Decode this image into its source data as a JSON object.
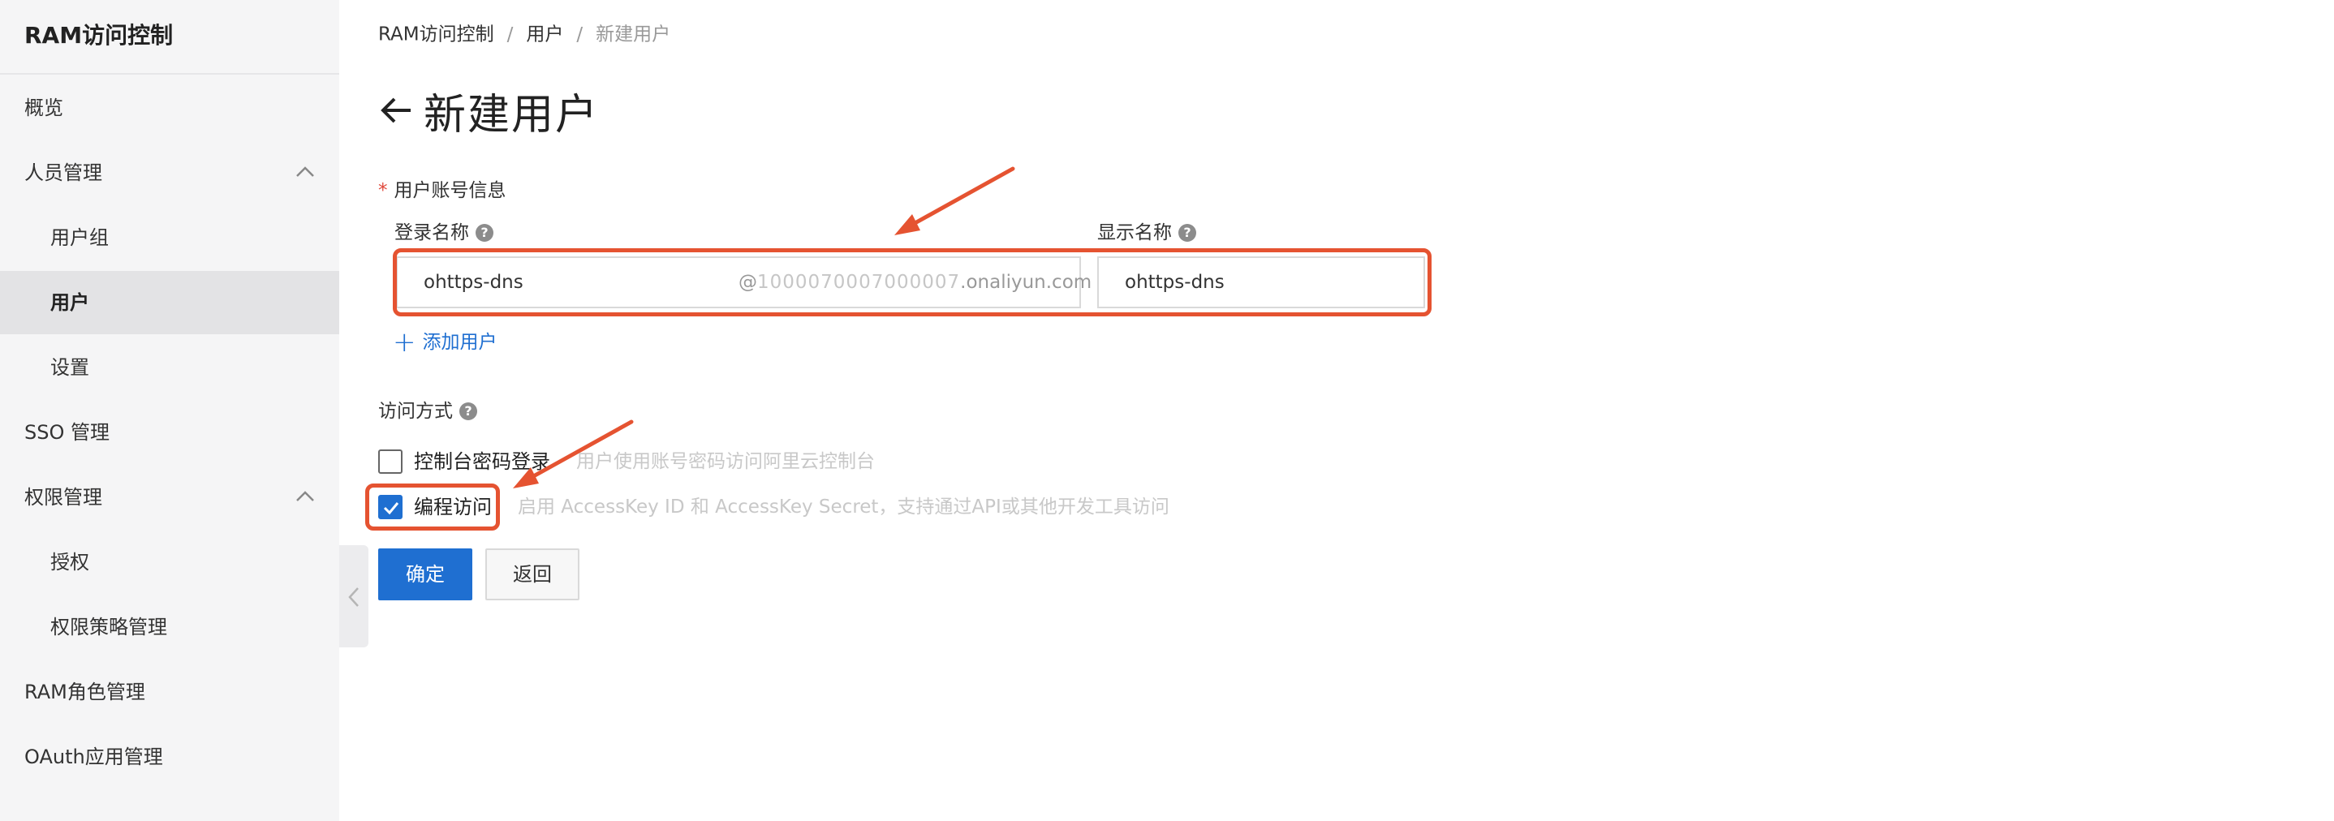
{
  "sidebar": {
    "title": "RAM访问控制",
    "items": [
      {
        "label": "概览"
      },
      {
        "label": "人员管理"
      },
      {
        "label": "用户组"
      },
      {
        "label": "用户"
      },
      {
        "label": "设置"
      },
      {
        "label": "SSO 管理"
      },
      {
        "label": "权限管理"
      },
      {
        "label": "授权"
      },
      {
        "label": "权限策略管理"
      },
      {
        "label": "RAM角色管理"
      },
      {
        "label": "OAuth应用管理"
      }
    ]
  },
  "breadcrumb": {
    "items": [
      "RAM访问控制",
      "用户",
      "新建用户"
    ],
    "separator": "/"
  },
  "page": {
    "title": "新建用户"
  },
  "form": {
    "account_section_label": "用户账号信息",
    "required_mark": "*",
    "login_name_label": "登录名称",
    "display_name_label": "显示名称",
    "help_glyph": "?",
    "login_name_value": "ohttps-dns",
    "login_suffix_at": "@",
    "login_suffix_masked": "1000070007000007",
    "login_suffix_domain": ".onaliyun.com",
    "display_name_value": "ohttps-dns",
    "add_user_plus": "+",
    "add_user_label": "添加用户",
    "access_section_label": "访问方式",
    "console_login_label": "控制台密码登录",
    "console_login_desc": "用户使用账号密码访问阿里云控制台",
    "console_login_checked": false,
    "programmatic_label": "编程访问",
    "programmatic_desc": "启用 AccessKey ID 和 AccessKey Secret，支持通过API或其他开发工具访问",
    "programmatic_checked": true,
    "confirm_label": "确定",
    "back_label": "返回"
  },
  "colors": {
    "accent": "#1f6fd1",
    "annotation": "#e55331",
    "sidebar_bg": "#f5f5f6"
  }
}
